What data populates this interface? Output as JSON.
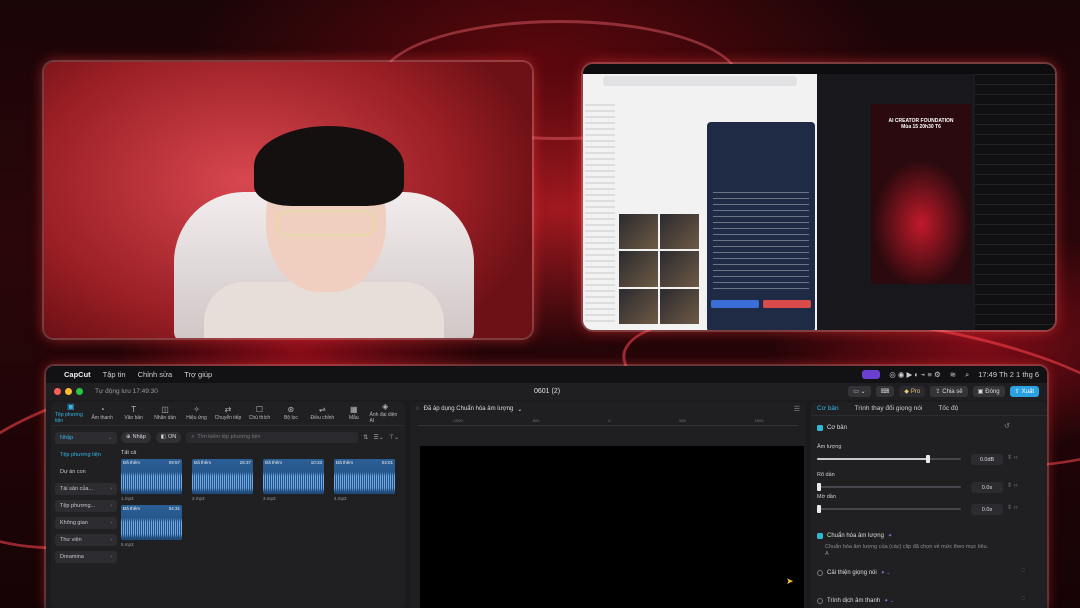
{
  "capcut": {
    "menubar": {
      "app": "CapCut",
      "items": [
        "Tập tin",
        "Chỉnh sửa",
        "Trợ giúp"
      ],
      "clock": "17:49 Th 2 1 thg 6"
    },
    "titlebar": {
      "saved": "Tự động lưu 17:49:30",
      "title": "0601 (2)",
      "pro": "Pro",
      "share": "Chia sẻ",
      "close": "Đóng",
      "export": "Xuất"
    },
    "toolbar": [
      "Tệp phương tiện",
      "Âm thanh",
      "Văn bản",
      "Nhãn dán",
      "Hiệu ứng",
      "Chuyển tiếp",
      "Chú thích",
      "Bộ lọc",
      "Điều chỉnh",
      "Mẫu",
      "Ảnh đại diện AI"
    ],
    "left_categories": [
      {
        "label": "Nhập",
        "style": "selbox",
        "chev": "⌄"
      },
      {
        "label": "Tệp phương tiện",
        "style": "sel",
        "chev": ""
      },
      {
        "label": "Dự án con",
        "style": "plain",
        "chev": ""
      },
      {
        "label": "Tài sản của...",
        "style": "box",
        "chev": "›"
      },
      {
        "label": "Tệp phương...",
        "style": "box",
        "chev": "›"
      },
      {
        "label": "Không gian",
        "style": "box",
        "chev": "›"
      },
      {
        "label": "Thư viện",
        "style": "box",
        "chev": "›"
      },
      {
        "label": "Dreamina",
        "style": "box",
        "chev": "›"
      }
    ],
    "media": {
      "import_label": "Nhập",
      "on_label": "ON",
      "search_placeholder": "Tìm kiếm tệp phương tiện",
      "section": "Tất cả",
      "clips": [
        {
          "tag": "Đã thêm",
          "duration": "09:57",
          "name": "1.mp3"
        },
        {
          "tag": "Đã thêm",
          "duration": "25:37",
          "name": "2.mp3"
        },
        {
          "tag": "Đã thêm",
          "duration": "10:33",
          "name": "3.mp3"
        },
        {
          "tag": "Đã thêm",
          "duration": "04:01",
          "name": "4.mp3"
        },
        {
          "tag": "Đã thêm",
          "duration": "04:31",
          "name": "5.mp3"
        }
      ]
    },
    "preview": {
      "status": "Đã áp dụng Chuẩn hóa âm lượng",
      "ruler": [
        "-1000",
        "-500",
        "0",
        "500",
        "1000"
      ]
    },
    "inspector": {
      "tabs": [
        "Cơ bản",
        "Trình thay đổi giọng nói",
        "Tốc độ"
      ],
      "basic": "Cơ bản",
      "volume_label": "Âm lượng",
      "volume_value": "0.0dB",
      "volume_level": 0.77,
      "fadein_label": "Rõ dần",
      "fadein_value": "0.0s",
      "fadein_level": 0,
      "fadeout_label": "Mờ dần",
      "fadeout_value": "0.0s",
      "fadeout_level": 0,
      "normalize_label": "Chuẩn hóa âm lượng",
      "normalize_desc": "Chuẩn hóa âm lượng của (các) clip đã chọn về mức theo mục tiêu.",
      "normalize_desc2": "A",
      "enhance_label": "Cải thiện giọng nói",
      "translate_label": "Trình dịch âm thanh"
    }
  },
  "screen_share": {
    "preview_title": "AI CREATOR FOUNDATION",
    "preview_sub": "Mùa 15 20h30 T6"
  },
  "colors": {
    "accent": "#35b7e8",
    "export": "#2aa1e0",
    "rec": "#6b3fd1"
  }
}
